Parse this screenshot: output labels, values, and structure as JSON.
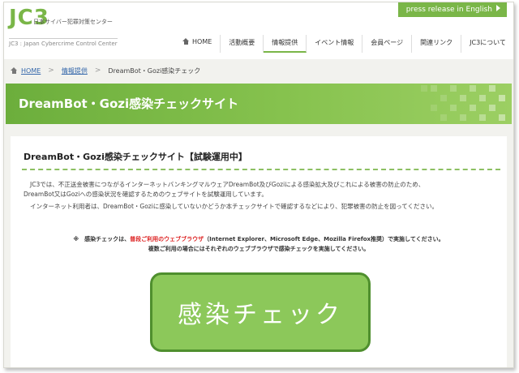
{
  "header": {
    "logo_mark": "JC3",
    "logo_sub_jp": "日本サイバー犯罪対策センター",
    "logo_sub_en": "JC3 : Japan Cybercrime Control Center",
    "press_release": "press release in English"
  },
  "nav": {
    "items": [
      {
        "label": "HOME"
      },
      {
        "label": "活動概要"
      },
      {
        "label": "情報提供"
      },
      {
        "label": "イベント情報"
      },
      {
        "label": "会員ページ"
      },
      {
        "label": "関連リンク"
      },
      {
        "label": "JC3について"
      }
    ],
    "active_index": 2
  },
  "breadcrumb": {
    "items": [
      "HOME",
      "情報提供",
      "DreamBot・Gozi感染チェック"
    ]
  },
  "banner": {
    "title": "DreamBot・Gozi感染チェックサイト"
  },
  "main": {
    "section_title": "DreamBot・Gozi感染チェックサイト【試験運用中】",
    "paragraphs": [
      "JC3では、不正送金被害につながるインターネットバンキングマルウェアDreamBot及びGoziによる感染拡大及びこれによる被害の防止のため、",
      "DreamBot又はGoziへの感染状況を確認するためのウェブサイトを試験運用しています。",
      "インターネット利用者は、DreamBot・Goziに感染していないかどうか本チェックサイトで確認するなどにより、犯罪被害の防止を図ってください。"
    ],
    "note": {
      "prefix": "※　感染チェックは、",
      "highlight": "普段ご利用のウェブブラウザ",
      "suffix": "（Internet Explorer、Microsoft Edge、Mozilla Firefox推奨）で実施してください。",
      "line2": "複数ご利用の場合にはそれぞれのウェブブラウザで感染チェックを実施してください。"
    },
    "check_button_label": "感染チェック"
  },
  "colors": {
    "accent_green": "#7ab648",
    "button_green": "#8cc85a",
    "button_border": "#4f8f2e",
    "highlight_red": "#dd2222"
  }
}
